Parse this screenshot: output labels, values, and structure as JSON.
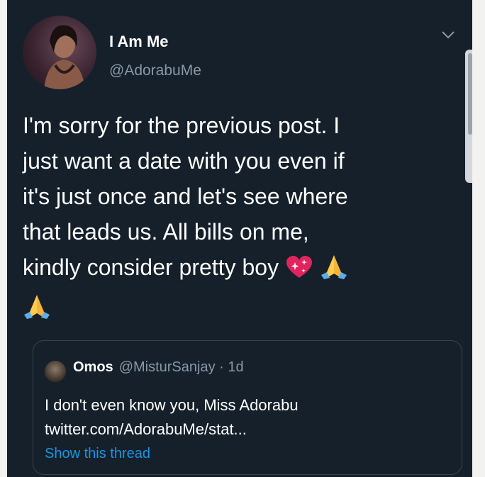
{
  "tweet": {
    "display_name": "I Am Me",
    "handle": "@AdorabuMe",
    "line1": "I'm sorry for the previous post. I",
    "line2": "just want a date with you even if",
    "line3": "it's just once and let's see where",
    "line4": "that leads us. All bills on me,",
    "line5": "kindly consider pretty boy",
    "emojis": [
      "sparkling-heart-icon",
      "folded-hands-icon",
      "folded-hands-icon"
    ]
  },
  "quote": {
    "name": "Omos",
    "handle": "@MisturSanjay",
    "separator": "·",
    "time": "1d",
    "text_line1": "I don't even know you, Miss Adorabu",
    "text_line2": "twitter.com/AdorabuMe/stat...",
    "show_thread": "Show this thread"
  },
  "colors": {
    "background": "#15202b",
    "text": "#ffffff",
    "secondary": "#8899a6",
    "link": "#1b95e0",
    "border": "#38444d"
  }
}
